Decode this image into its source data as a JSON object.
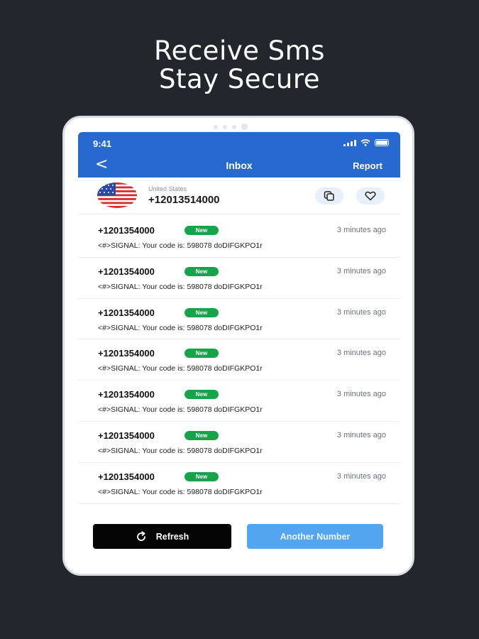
{
  "promo": {
    "line1": "Receive Sms",
    "line2": "Stay Secure"
  },
  "status_bar": {
    "time": "9:41"
  },
  "appbar": {
    "back_symbol": "<",
    "title": "Inbox",
    "report_label": "Report"
  },
  "number_card": {
    "country": "United States",
    "phone_number": "+12013514000",
    "flag_icon": "us-flag-icon",
    "copy_icon": "copy-icon",
    "favorite_icon": "heart-icon"
  },
  "messages": [
    {
      "sender": "+1201354000",
      "badge": "New",
      "time": "3 minutes ago",
      "body": "<#>SIGNAL: Your code is: 598078 doDIFGKPO1r"
    },
    {
      "sender": "+1201354000",
      "badge": "New",
      "time": "3 minutes ago",
      "body": "<#>SIGNAL: Your code is: 598078 doDIFGKPO1r"
    },
    {
      "sender": "+1201354000",
      "badge": "New",
      "time": "3 minutes ago",
      "body": "<#>SIGNAL: Your code is: 598078 doDIFGKPO1r"
    },
    {
      "sender": "+1201354000",
      "badge": "New",
      "time": "3 minutes ago",
      "body": "<#>SIGNAL: Your code is: 598078 doDIFGKPO1r"
    },
    {
      "sender": "+1201354000",
      "badge": "New",
      "time": "3 minutes ago",
      "body": "<#>SIGNAL: Your code is: 598078 doDIFGKPO1r"
    },
    {
      "sender": "+1201354000",
      "badge": "New",
      "time": "3 minutes ago",
      "body": "<#>SIGNAL: Your code is: 598078 doDIFGKPO1r"
    },
    {
      "sender": "+1201354000",
      "badge": "New",
      "time": "3 minutes ago",
      "body": "<#>SIGNAL: Your code is: 598078 doDIFGKPO1r"
    }
  ],
  "actions": {
    "refresh_label": "Refresh",
    "refresh_icon": "refresh-icon",
    "another_label": "Another Number"
  },
  "colors": {
    "background": "#23272d",
    "appbar": "#2769cf",
    "badge": "#17a34a",
    "refresh_button": "#050505",
    "another_button": "#54a5f0"
  }
}
